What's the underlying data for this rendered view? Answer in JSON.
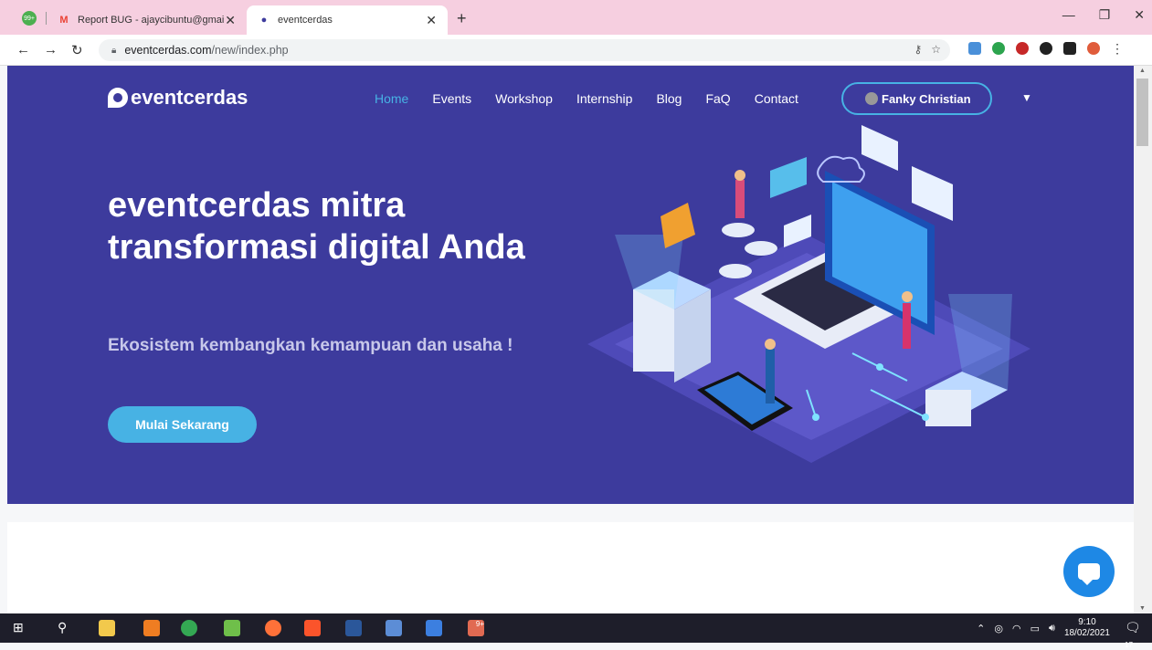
{
  "browser": {
    "tabs": [
      {
        "title": "Report BUG - ajaycibuntu@gmai",
        "icon": "gmail-icon"
      },
      {
        "title": "eventcerdas",
        "icon": "eventcerdas-favicon"
      }
    ],
    "pinned_badge": "99+",
    "url_domain": "eventcerdas.com",
    "url_path": "/new/index.php"
  },
  "site": {
    "logo_text": "eventcerdas",
    "nav": [
      "Home",
      "Events",
      "Workshop",
      "Internship",
      "Blog",
      "FaQ",
      "Contact"
    ],
    "user_name": "Fanky Christian",
    "hero_title": "eventcerdas mitra transformasi digital Anda",
    "hero_subtitle": "Ekosistem kembangkan kemampuan dan usaha !",
    "cta_label": "Mulai Sekarang"
  },
  "colors": {
    "hero_bg": "#3d3b9d",
    "accent": "#47b2e4",
    "chat": "#1e88e5"
  },
  "taskbar": {
    "time": "9:10",
    "date": "18/02/2021",
    "notification_count": "17",
    "app_badge": "9+"
  }
}
